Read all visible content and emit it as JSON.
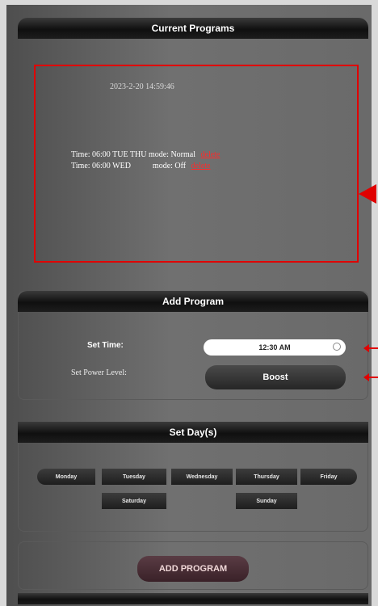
{
  "current_programs": {
    "header": "Current Programs",
    "datetime": "2023-2-20 14:59:46",
    "programs": [
      {
        "time": "Time: 06:00",
        "days": "TUE THU",
        "mode": "mode: Normal",
        "delete": "delete"
      },
      {
        "time": "Time: 06:00",
        "days": "WED",
        "mode": "mode: Off",
        "delete": "delete"
      }
    ]
  },
  "add_program": {
    "header": "Add Program",
    "set_time_label": "Set Time:",
    "time_value": "12:30 AM",
    "set_power_label": "Set Power Level:",
    "boost_label": "Boost"
  },
  "set_days": {
    "header": "Set Day(s)",
    "days": [
      "Monday",
      "Tuesday",
      "Wednesday",
      "Thursday",
      "Friday",
      "Saturday",
      "Sunday"
    ]
  },
  "add_program_button": "ADD PROGRAM",
  "colors": {
    "highlight": "#e00000",
    "panel": "#6a6a6a",
    "header": "#151515",
    "accent_button": "#4a2e35"
  }
}
